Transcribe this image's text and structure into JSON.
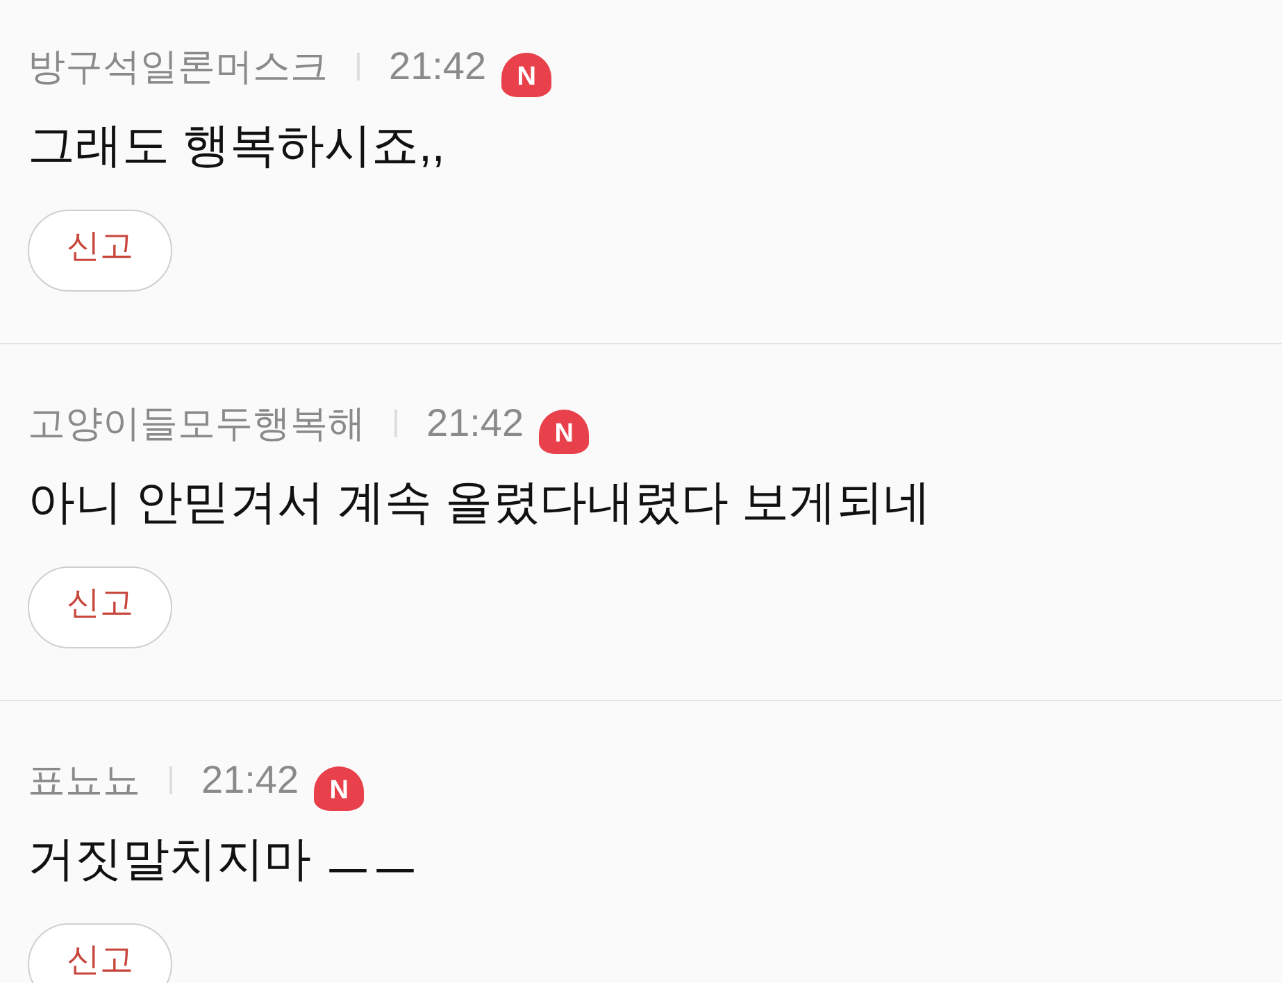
{
  "comments": [
    {
      "author": "방구석일론머스크",
      "time": "21:42",
      "badge": "N",
      "text": "그래도 행복하시죠,,",
      "report_button": "신고"
    },
    {
      "author": "고양이들모두행복해",
      "time": "21:42",
      "badge": "N",
      "text": "아니 안믿겨서 계속 올렸다내렸다 보게되네",
      "report_button": "신고"
    },
    {
      "author": "표뇨뇨",
      "time": "21:42",
      "badge": "N",
      "text": "거짓말치지마 ㅡㅡ",
      "report_button": "신고"
    }
  ]
}
